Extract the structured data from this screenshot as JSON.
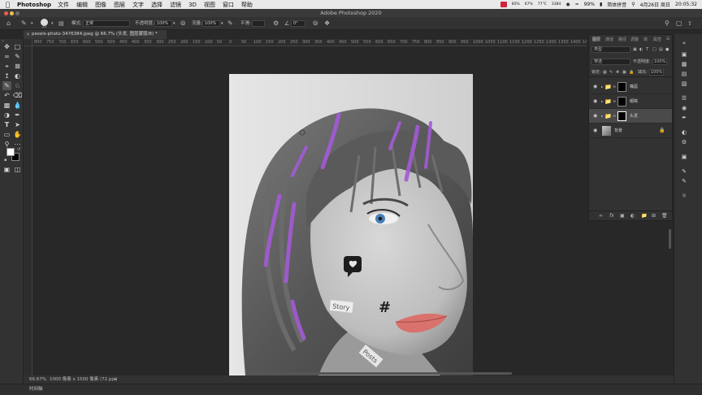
{
  "menubar": {
    "app_name": "Photoshop",
    "items": [
      "文件",
      "编辑",
      "图像",
      "图层",
      "文字",
      "选择",
      "滤镜",
      "3D",
      "视图",
      "窗口",
      "帮助"
    ],
    "status": {
      "cpu_pct": "85%",
      "mem_pct": "67%",
      "temp": "77°C",
      "net": "3384",
      "battery_pct": "99%",
      "input_method": "简体拼音",
      "date": "4月26日 周日",
      "time": "20:05:32"
    }
  },
  "window": {
    "title": "Adobe Photoshop 2020"
  },
  "options_bar": {
    "brush_size": "25",
    "mode_label": "模式:",
    "mode_value": "正常",
    "opacity_label": "不透明度:",
    "opacity_value": "100%",
    "flow_label": "流量:",
    "flow_value": "100%",
    "smoothing_label": "平滑:",
    "angle_value": "0°"
  },
  "document": {
    "tab_title": "pexels-photo-3476384.jpeg @ 66.7% (头发, 图层蒙版/8) *",
    "tab_close": "×"
  },
  "ruler": {
    "ticks": [
      "800",
      "750",
      "700",
      "650",
      "600",
      "550",
      "500",
      "450",
      "400",
      "350",
      "300",
      "250",
      "200",
      "150",
      "100",
      "50",
      "0",
      "50",
      "100",
      "150",
      "200",
      "250",
      "300",
      "350",
      "400",
      "450",
      "500",
      "550",
      "600",
      "650",
      "700",
      "750",
      "800",
      "850",
      "900",
      "950",
      "1000",
      "1050",
      "1100",
      "1150",
      "1200",
      "1250",
      "1300",
      "1350",
      "1400",
      "1450"
    ]
  },
  "statusbar": {
    "zoom": "66.67%",
    "doc_info": "1000 像素 x 1500 像素 (72 ppi)"
  },
  "timeline": {
    "label": "时间轴"
  },
  "layers_panel": {
    "tabs": [
      "图层",
      "通道",
      "路径",
      "调整",
      "库",
      "属性"
    ],
    "filter_kind": "类型",
    "blend_mode": "穿透",
    "opacity_label": "不透明度:",
    "opacity_value": "100%",
    "lock_label": "锁定:",
    "fill_label": "填充:",
    "fill_value": "100%",
    "layers": [
      {
        "name": "嘴唇",
        "type": "group",
        "selected": false
      },
      {
        "name": "眼睛",
        "type": "group",
        "selected": false
      },
      {
        "name": "头发",
        "type": "group",
        "selected": true
      },
      {
        "name": "背景",
        "type": "background",
        "selected": false
      }
    ],
    "footer_icons": [
      "link-icon",
      "fx-icon",
      "mask-icon",
      "adjustment-icon",
      "folder-icon",
      "new-layer-icon",
      "trash-icon"
    ]
  },
  "stickers": {
    "story": "Story",
    "posts": "Posts",
    "hashtag": "#"
  },
  "colors": {
    "accent_purple": "#a35ad6",
    "lips": "#d9726d",
    "eye_blue": "#4a7fb8",
    "selected_layer": "#4a4a4a"
  }
}
